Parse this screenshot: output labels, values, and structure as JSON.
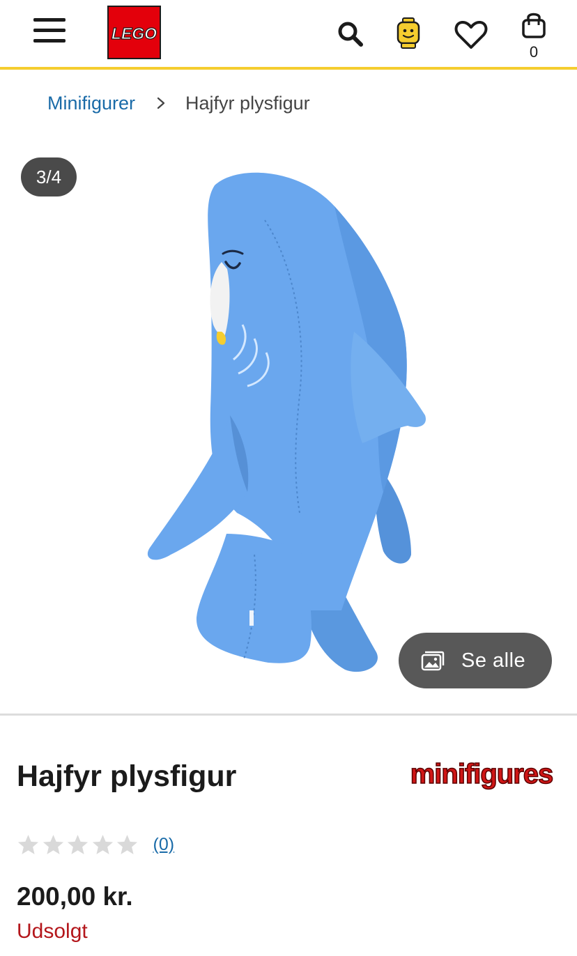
{
  "header": {
    "logo_text": "LEGO",
    "bag_count": "0"
  },
  "breadcrumb": {
    "parent": "Minifigurer",
    "current": "Hajfyr plysfigur"
  },
  "gallery": {
    "counter": "3/4",
    "see_all_label": "Se alle"
  },
  "product": {
    "title": "Hajfyr plysfigur",
    "brand_logo_text": "minifigures",
    "rating": {
      "stars_filled": 0,
      "stars_total": 5,
      "review_count": "(0)"
    },
    "price": "200,00 kr.",
    "stock_status": "Udsolgt"
  },
  "colors": {
    "header_accent": "#f5cd2f",
    "lego_red": "#e3000b",
    "link_blue": "#1a6ba8",
    "sold_out_red": "#b4161b",
    "plush_blue": "#5f9ee6"
  },
  "icons": [
    "menu-icon",
    "search-icon",
    "vip-minifig-icon",
    "heart-icon",
    "bag-icon",
    "chevron-right-icon",
    "gallery-icon",
    "star-icon"
  ]
}
